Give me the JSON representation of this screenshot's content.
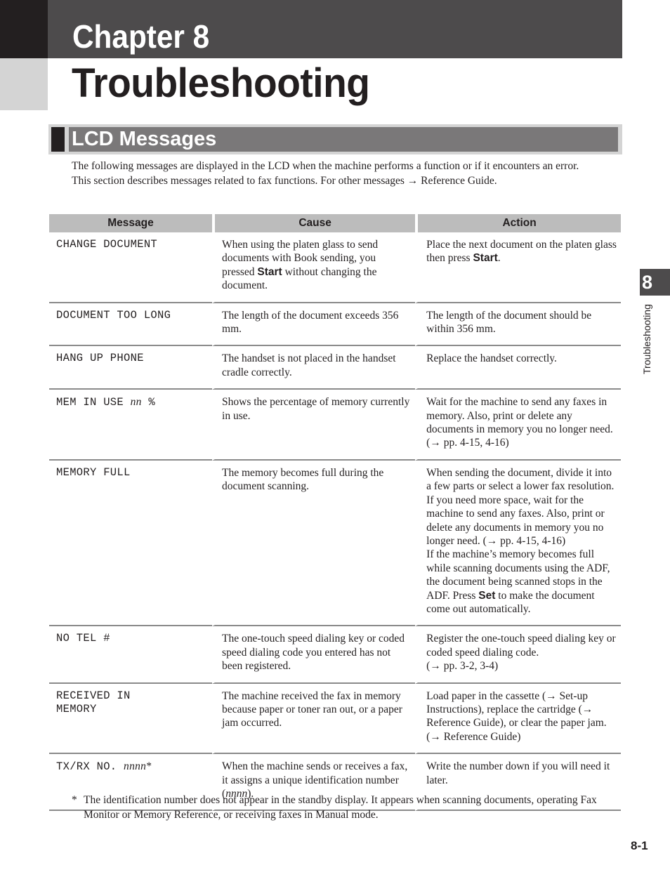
{
  "header": {
    "chapter_label": "Chapter 8",
    "chapter_title": "Troubleshooting"
  },
  "section": {
    "title": "LCD Messages",
    "intro": [
      "The following messages are displayed in the LCD when the machine performs a function or if it encounters an error.",
      "This section describes messages related to fax functions. For other messages → Reference Guide."
    ]
  },
  "table": {
    "headers": [
      "Message",
      "Cause",
      "Action"
    ],
    "rows": [
      {
        "message": "CHANGE DOCUMENT",
        "cause_pre": "When using the platen glass to send documents with Book sending, you pressed ",
        "cause_key": "Start",
        "cause_post": " without changing the document.",
        "action_pre": "Place the next document on the platen glass then press ",
        "action_key": "Start",
        "action_post": "."
      },
      {
        "message": "DOCUMENT TOO LONG",
        "cause": "The length of the document exceeds 356 mm.",
        "action": "The length of the document should be within 356 mm."
      },
      {
        "message": "HANG UP PHONE",
        "cause": "The handset is not placed in the handset cradle correctly.",
        "action": "Replace the handset correctly."
      },
      {
        "message_pre": "MEM IN USE ",
        "message_var": "nn",
        "message_post": " %",
        "cause": "Shows the percentage of memory currently in use.",
        "action": "Wait for the machine to send any faxes in memory. Also, print or delete any documents in memory you no longer need. (→ pp. 4-15, 4-16)"
      },
      {
        "message": "MEMORY FULL",
        "cause": "The memory becomes full during the document scanning.",
        "action_lines": [
          "When sending the document, divide it into a few parts or select a lower fax resolution.",
          "If you need more space, wait for the machine to send any faxes. Also, print or delete any documents in memory you no longer need. (→ pp. 4-15, 4-16)"
        ],
        "action_pre": "If the machine’s memory becomes full while scanning documents using the ADF, the document being scanned stops in the ADF. Press ",
        "action_key": "Set",
        "action_post": " to make the document come out automatically."
      },
      {
        "message": "NO TEL #",
        "cause": "The one-touch speed dialing key or coded speed dialing code you entered has not been registered.",
        "action": "Register the one-touch speed dialing key or coded speed dialing code.",
        "action_ref": "(→ pp. 3-2, 3-4)"
      },
      {
        "message": "RECEIVED IN MEMORY",
        "cause": "The machine received the fax in memory because paper or toner ran out, or a paper jam occurred.",
        "action": "Load paper in the cassette (→ Set-up Instructions), replace the cartridge (→ Reference Guide), or clear the paper jam. (→ Reference Guide)"
      },
      {
        "message_pre": "TX/RX NO. ",
        "message_var": "nnnn",
        "message_post": "*",
        "cause_pre": "When the machine sends or receives a fax, it assigns a unique identification number (",
        "cause_var": "nnnn",
        "cause_post": ").",
        "action": "Write the number down if you will need it later."
      }
    ]
  },
  "footnote": {
    "marker": "*",
    "text": "The identification number does not appear in the standby display. It appears when scanning documents, operating Fax Monitor or Memory Reference, or receiving faxes in Manual mode."
  },
  "side_tab": {
    "number": "8",
    "label": "Troubleshooting"
  },
  "page_number": "8-1"
}
